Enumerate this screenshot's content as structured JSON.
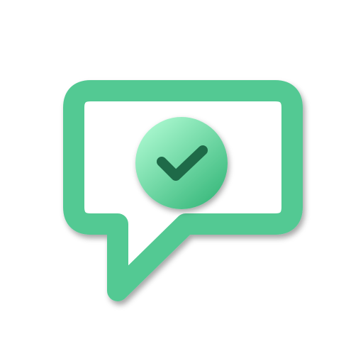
{
  "icon": {
    "name": "chat-bubble-check-icon",
    "colors": {
      "bubble_stroke": "#52c993",
      "bubble_fill": "#ffffff",
      "badge_light": "#a7f6cd",
      "badge_dark": "#3dbb7f",
      "checkmark": "#1e6a48",
      "background": "#ffffff"
    }
  }
}
